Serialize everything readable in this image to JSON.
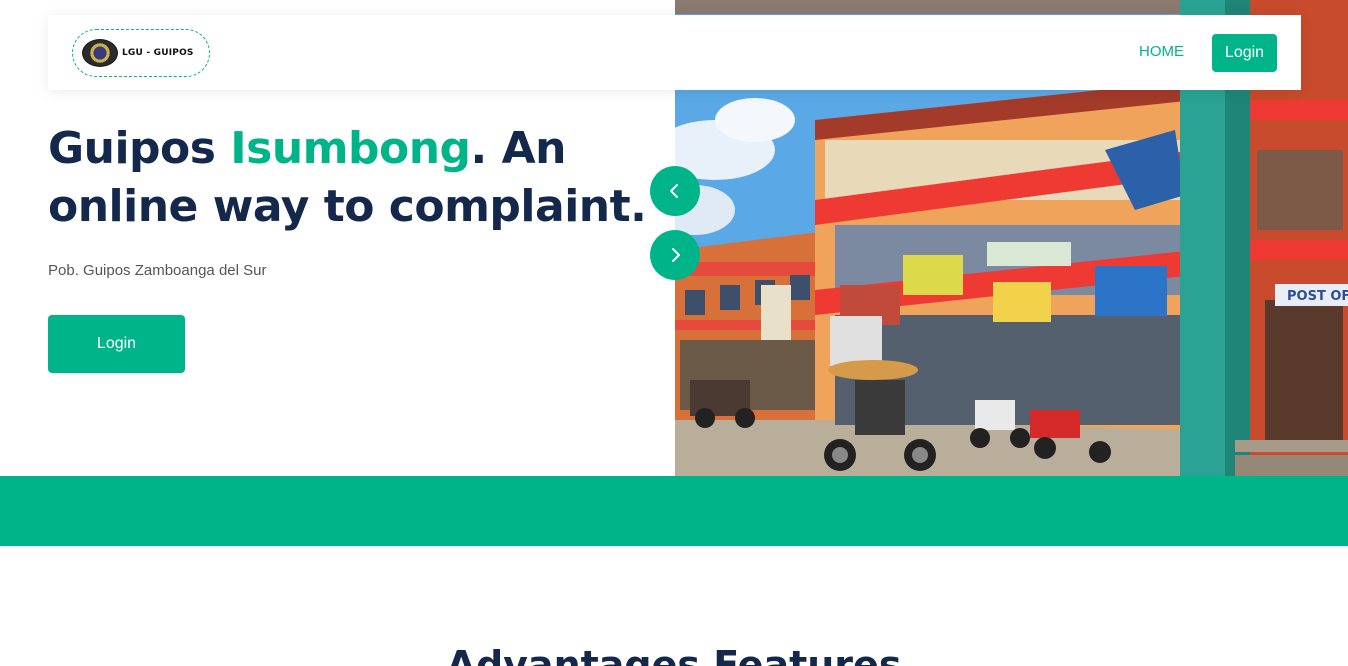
{
  "navbar": {
    "logo_text": "LGU - GUIPOS",
    "home_label": "HOME",
    "login_label": "Login"
  },
  "hero": {
    "headline_part1": "Guipos ",
    "headline_accent": "Isumbong",
    "headline_part2": ". An online way to complaint.",
    "subtitle": "Pob. Guipos Zamboanga del Sur",
    "cta_label": "Login",
    "photo_signs": {
      "post_office": "POST OF"
    }
  },
  "section": {
    "title": "Advantages Features"
  },
  "colors": {
    "accent": "#00b48a",
    "heading": "#14284b"
  },
  "icons": {
    "prev": "chevron-left-icon",
    "next": "chevron-right-icon"
  }
}
